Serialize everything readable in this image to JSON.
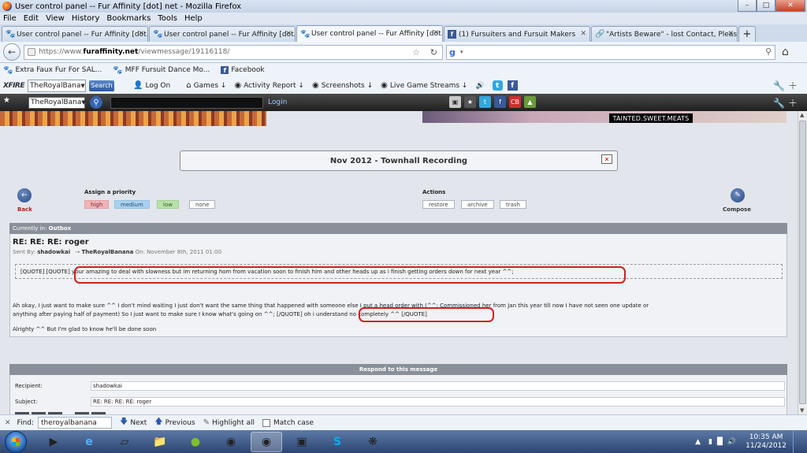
{
  "window": {
    "title": "User control panel -- Fur Affinity [dot] net - Mozilla Firefox"
  },
  "menu": [
    "File",
    "Edit",
    "View",
    "History",
    "Bookmarks",
    "Tools",
    "Help"
  ],
  "tabs": [
    {
      "label": "User control panel -- Fur Affinity [dot...",
      "icon": "paw-icon",
      "active": false
    },
    {
      "label": "User control panel -- Fur Affinity [dot...",
      "icon": "paw-icon",
      "active": false
    },
    {
      "label": "User control panel -- Fur Affinity [dot...",
      "icon": "paw-icon",
      "active": true
    },
    {
      "label": "(1) Fursuiters and Fursuit Makers",
      "icon": "facebook-icon",
      "active": false
    },
    {
      "label": "\"Artists Beware\" - lost Contact, Please...",
      "icon": "link-icon",
      "active": false
    }
  ],
  "url": {
    "prefix": "https://www.",
    "domain": "furaffinity.net",
    "path": "/viewmessage/19116118/"
  },
  "bookmarks": [
    {
      "label": "Extra Faux Fur For SAL...",
      "icon": "paw-icon"
    },
    {
      "label": "MFF Fursuit Dance Mo...",
      "icon": "paw-icon"
    },
    {
      "label": "Facebook",
      "icon": "facebook-icon"
    }
  ],
  "xfire": {
    "logo": "XFIRE",
    "username": "TheRoyalBana",
    "search_label": "Search",
    "items": [
      {
        "label": "Log On",
        "icon": "person-icon"
      },
      {
        "label": "Games ↓",
        "icon": "house-icon"
      },
      {
        "label": "Activity Report ↓",
        "icon": "camera-icon"
      },
      {
        "label": "Screenshots ↓",
        "icon": "camera-icon"
      },
      {
        "label": "Live Game Streams ↓",
        "icon": "broadcast-icon"
      }
    ]
  },
  "darkbar": {
    "username": "TheRoyalBana",
    "login_label": "Login"
  },
  "banner": {
    "tag": "TAINTED.SWEET.MEATS"
  },
  "announcement": "Nov 2012 - Townhall Recording",
  "actions": {
    "back_label": "Back",
    "compose_label": "Compose",
    "priority_title": "Assign a priority",
    "priorities": [
      "high",
      "medium",
      "low",
      "none"
    ],
    "actions_title": "Actions",
    "action_buttons": [
      "restore",
      "archive",
      "trash"
    ]
  },
  "folder": {
    "prefix": "Currently in:",
    "name": "Outbox"
  },
  "message": {
    "subject": "RE: RE: RE: roger",
    "sent_by_label": "Sent By:",
    "sender": "shadowkai",
    "recipient": "TheRoyalBanana",
    "date": "On: November 8th, 2011 01:00",
    "quote": "[QUOTE] [QUOTE] your amazing to deal with slowness but im returning hom from vacation soon to finish him and other heads up as i finish getting orders down for next year ^^;",
    "body_line1": "Ah okay, I just want to make sure ^^ I don't mind waiting I just don't want the same thing that happened with someone else I put a head order with (^^; Commissioned her from Jan this year till now I have not seen one update or",
    "body_line2": "anything after paying half of payment) So I just want to make sure I know what's going on ^^; [/QUOTE] oh i understand no completely ^^ [/QUOTE]",
    "footer": "Alrighty ^^ But I'm glad to know he'll be done soon"
  },
  "respond": {
    "title": "Respond to this message",
    "recipient_label": "Recipient:",
    "recipient_value": "shadowkai",
    "subject_label": "Subject:",
    "subject_value": "RE: RE: RE: RE: roger"
  },
  "findbar": {
    "find_label": "Find:",
    "query": "theroyalbanana",
    "next_label": "Next",
    "previous_label": "Previous",
    "highlight_label": "Highlight all",
    "matchcase_label": "Match case"
  },
  "taskbar": {
    "time": "10:35 AM",
    "date": "11/24/2012"
  },
  "colors": {
    "highlight_red": "#d41f1f",
    "header_gray": "#8a9099",
    "page_bg": "#e2e6ec"
  }
}
